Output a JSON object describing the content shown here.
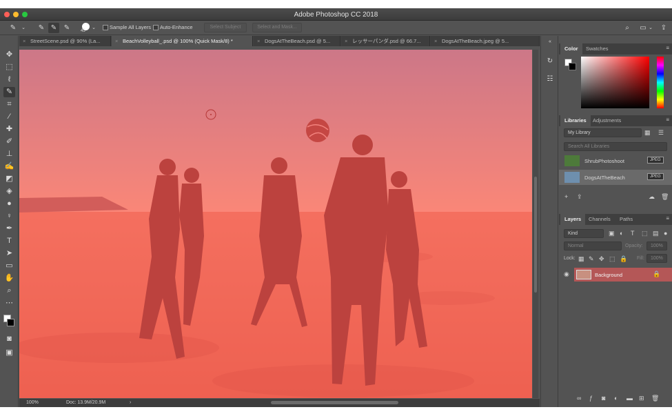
{
  "window": {
    "title": "Adobe Photoshop CC 2018"
  },
  "options_bar": {
    "brush_size": "45",
    "sample_all_layers": "Sample All Layers",
    "auto_enhance": "Auto-Enhance",
    "select_subject": "Select Subject",
    "select_and_mask": "Select and Mask..."
  },
  "tabs": [
    {
      "label": "StreetScene.psd @ 90% (La..."
    },
    {
      "label": "BeachVolleyball_.psd @ 100% (Quick Mask/8) *"
    },
    {
      "label": "DogsAtTheBeach.psd @ 5..."
    },
    {
      "label": "レッサーパンダ.psd @ 66.7..."
    },
    {
      "label": "DogsAtTheBeach.jpeg @ 5..."
    }
  ],
  "status": {
    "zoom": "100%",
    "doc": "Doc: 13.9M/20.9M",
    "arrow": "›"
  },
  "color_panel": {
    "tab_color": "Color",
    "tab_swatches": "Swatches"
  },
  "libraries_panel": {
    "tab_libraries": "Libraries",
    "tab_adjustments": "Adjustments",
    "library_select": "My Library",
    "search_placeholder": "Search All Libraries",
    "items": [
      {
        "name": "ShrubPhotoshoot",
        "badge": "JPEG"
      },
      {
        "name": "DogsAtTheBeach",
        "badge": "JPEG"
      }
    ]
  },
  "layers_panel": {
    "tab_layers": "Layers",
    "tab_channels": "Channels",
    "tab_paths": "Paths",
    "filter_kind": "Kind",
    "blend_mode": "Normal",
    "opacity_label": "Opacity:",
    "opacity_value": "100%",
    "lock_label": "Lock:",
    "fill_label": "Fill:",
    "fill_value": "100%",
    "layers": [
      {
        "name": "Background"
      }
    ]
  },
  "colors": {
    "quick_mask": "#ff4646",
    "layer_selected": "#b45757"
  }
}
